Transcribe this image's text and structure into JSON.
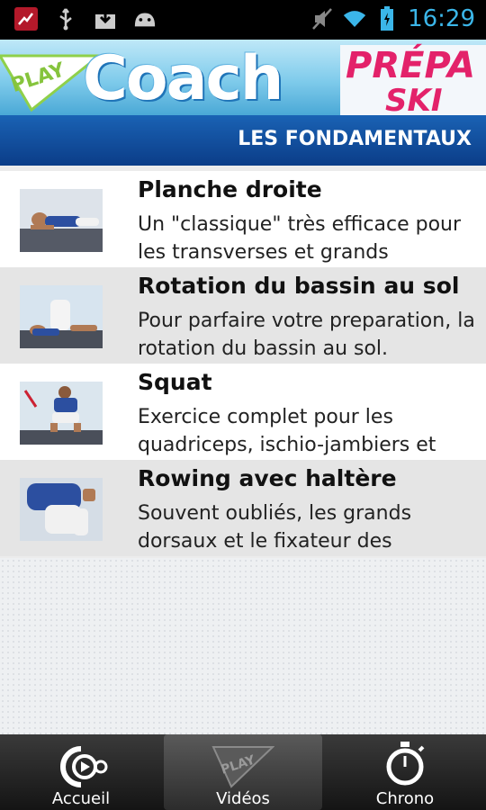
{
  "status_bar": {
    "time": "16:29"
  },
  "header": {
    "play": "PLAY",
    "coach": "Coach",
    "prepa": "PRÉPA",
    "ski": "SKI",
    "section_title": "LES FONDAMENTAUX"
  },
  "exercises": [
    {
      "title": "Planche droite",
      "description": "Un \"classique\" très efficace pour les transverses et grands"
    },
    {
      "title": "Rotation du bassin au sol",
      "description": "Pour parfaire votre preparation, la rotation du bassin au sol."
    },
    {
      "title": "Squat",
      "description": "Exercice complet pour les quadriceps, ischio-jambiers et"
    },
    {
      "title": "Rowing avec haltère",
      "description": "Souvent oubliés, les grands dorsaux et le fixateur des"
    }
  ],
  "nav": {
    "home_label": "Accueil",
    "videos_label": "Vidéos",
    "chrono_label": "Chrono",
    "videos_icon_text": "PLAY"
  }
}
